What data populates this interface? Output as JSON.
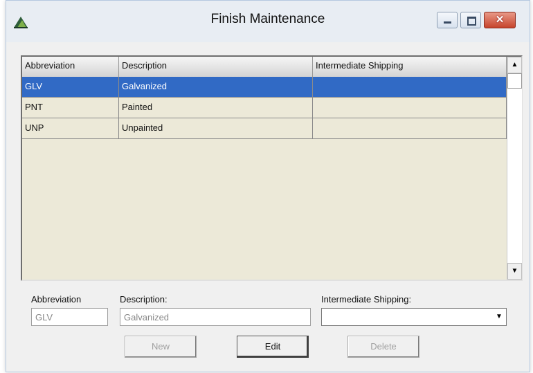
{
  "window": {
    "title": "Finish Maintenance",
    "controls": {
      "close_glyph": "✕"
    }
  },
  "grid": {
    "columns": [
      "Abbreviation",
      "Description",
      "Intermediate Shipping"
    ],
    "rows": [
      {
        "abbreviation": "GLV",
        "description": "Galvanized",
        "intermediate_shipping": "",
        "selected": true
      },
      {
        "abbreviation": "PNT",
        "description": "Painted",
        "intermediate_shipping": "",
        "selected": false
      },
      {
        "abbreviation": "UNP",
        "description": "Unpainted",
        "intermediate_shipping": "",
        "selected": false
      }
    ],
    "scroll_up_glyph": "▲",
    "scroll_down_glyph": "▼"
  },
  "form": {
    "abbreviation_label": "Abbreviation",
    "abbreviation_value": "GLV",
    "description_label": "Description:",
    "description_value": "Galvanized",
    "intermediate_label": "Intermediate Shipping:",
    "intermediate_value": "",
    "dropdown_glyph": "▼"
  },
  "buttons": {
    "new_label": "New",
    "edit_label": "Edit",
    "delete_label": "Delete"
  },
  "colors": {
    "selection": "#316ac5",
    "grid_background": "#ece9d8"
  }
}
